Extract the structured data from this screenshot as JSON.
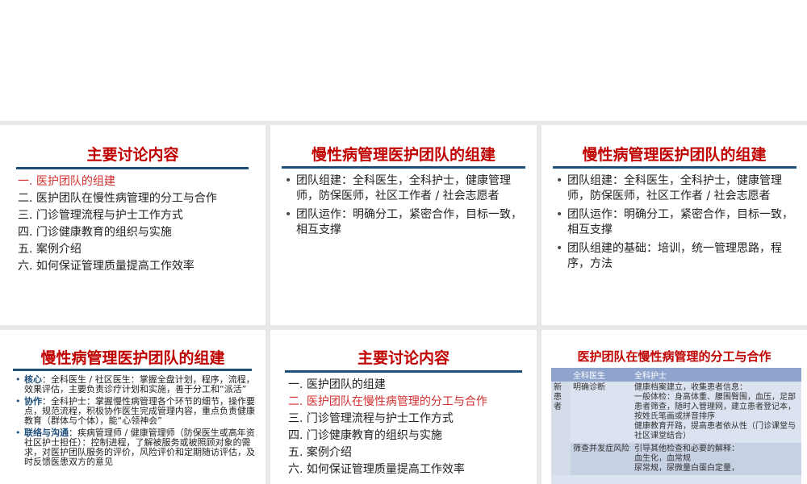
{
  "slides": {
    "s1": {
      "title": "主要讨论内容",
      "items": [
        "一. 医护团队的组建",
        "二. 医护团队在慢性病管理的分工与合作",
        "三. 门诊管理流程与护士工作方式",
        "四. 门诊健康教育的组织与实施",
        "五. 案例介绍",
        "六. 如何保证管理质量提高工作效率"
      ]
    },
    "s2": {
      "title": "慢性病管理医护团队的组建",
      "bullets": [
        "团队组建：全科医生，全科护士，健康管理师，防保医师，社区工作者 / 社会志愿者",
        "团队运作：明确分工，紧密合作，目标一致，相互支撑"
      ]
    },
    "s3": {
      "title": "慢性病管理医护团队的组建",
      "bullets": [
        "团队组建：全科医生，全科护士，健康管理师，防保医师，社区工作者 / 社会志愿者",
        "团队运作：明确分工，紧密合作，目标一致，相互支撑",
        "团队组建的基础：培训，统一管理思路，程序，方法"
      ]
    },
    "s4": {
      "title": "慢性病管理医护团队的组建",
      "bullets": [
        {
          "kw": "核心",
          "text": "：全科医生 / 社区医生：掌握全盘计划，程序，流程，效果评估，主要负责诊疗计划和实施，善于分工和“派活”"
        },
        {
          "kw": "协作",
          "text": "：全科护士：掌握慢性病管理各个环节的细节，操作要点，规范流程，积极协作医生完成管理内容，重点负责健康教育（群体与个体），能“心领神会”"
        },
        {
          "kw": "联络与沟通",
          "text": "：疾病管理师 / 健康管理师（防保医生或高年资社区护士担任）：控制进程，了解被服务或被照顾对象的需求，对医护团队服务的评价，风险评价和定期随访评估，及时反馈医患双方的意见"
        }
      ]
    },
    "s5": {
      "title": "主要讨论内容",
      "items": [
        "一. 医护团队的组建",
        "二. 医护团队在慢性病管理的分工与合作",
        "三. 门诊管理流程与护士工作方式",
        "四. 门诊健康教育的组织与实施",
        "五. 案例介绍",
        "六. 如何保证管理质量提高工作效率"
      ]
    },
    "s6": {
      "title": "医护团队在慢性病管理的分工与合作",
      "table": {
        "headers": [
          "",
          "全科医生",
          "全科护士"
        ],
        "group": "新\n患\n者",
        "rows": [
          {
            "doctor": "明确诊断",
            "nurse": "健康档案建立，收集患者信息：\n一般体检：身高体重、腰围臀围，血压，足部\n患者筛查，随时入管理网，建立患者登记本，按姓氏笔画或拼音排序\n健康教育开路，提高患者依从性（门诊课堂与社区课堂结合）"
          },
          {
            "doctor": "筛查并发症风险",
            "nurse": "引导其他检查和必要的解释：\n血生化，血常规\n尿常规，尿微量白蛋白定量，"
          }
        ]
      }
    }
  }
}
